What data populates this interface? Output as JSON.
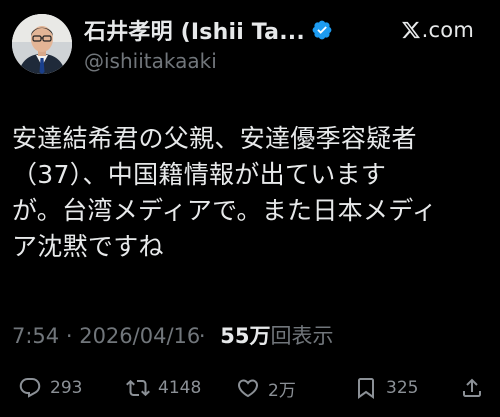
{
  "author": {
    "display_name": "石井孝明 (Ishii Ta...",
    "handle": "@ishiitakaaki",
    "verified": true
  },
  "brand": {
    "logo_icon": "x-logo-icon",
    "text": ".com"
  },
  "tweet": {
    "lines": [
      "安達結希君の父親、安達優季容疑者",
      "（37）、中国籍情報が出ています",
      "が。台湾メディアで。また日本メディ",
      "ア沈黙ですね"
    ]
  },
  "meta": {
    "time": "7:54",
    "separator": " · ",
    "date": "2026/04/16",
    "separator2": " · ",
    "views_count": "55万",
    "views_label": "回表示"
  },
  "actions": {
    "reply_count": "293",
    "retweet_count": "4148",
    "like_count": "2万",
    "bookmark_count": "325"
  },
  "colors": {
    "background": "#000000",
    "text": "#e7e9ea",
    "secondary": "#71767b",
    "verified": "#1d9bf0"
  }
}
